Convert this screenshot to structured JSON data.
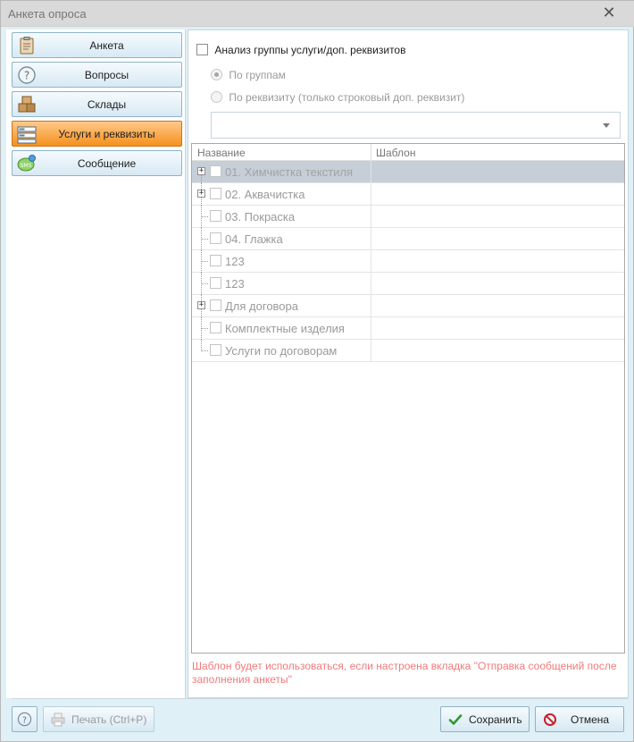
{
  "window": {
    "title": "Анкета опроса",
    "close_glyph": "✕"
  },
  "nav": {
    "items": [
      {
        "label": "Анкета",
        "icon": "clipboard-icon",
        "active": false
      },
      {
        "label": "Вопросы",
        "icon": "question-icon",
        "active": false
      },
      {
        "label": "Склады",
        "icon": "boxes-icon",
        "active": false
      },
      {
        "label": "Услуги и реквизиты",
        "icon": "list-form-icon",
        "active": true
      },
      {
        "label": "Сообщение",
        "icon": "sms-icon",
        "active": false
      }
    ]
  },
  "content": {
    "analysis_checkbox_label": "Анализ группы услуги/доп. реквизитов",
    "radio_by_groups": "По группам",
    "radio_by_attribute": "По реквизиту (только строковый доп. реквизит)",
    "combo_value": "",
    "grid": {
      "columns": [
        "Название",
        "Шаблон"
      ],
      "rows": [
        {
          "name": "01. Химчистка текстиля",
          "template": "",
          "expandable": true,
          "selected": true
        },
        {
          "name": "02. Аквачистка",
          "template": "",
          "expandable": true,
          "selected": false
        },
        {
          "name": "03. Покраска",
          "template": "",
          "expandable": false,
          "selected": false
        },
        {
          "name": "04. Глажка",
          "template": "",
          "expandable": false,
          "selected": false
        },
        {
          "name": "123",
          "template": "",
          "expandable": false,
          "selected": false
        },
        {
          "name": "123",
          "template": "",
          "expandable": false,
          "selected": false
        },
        {
          "name": "Для договора",
          "template": "",
          "expandable": true,
          "selected": false
        },
        {
          "name": "Комплектные изделия",
          "template": "",
          "expandable": false,
          "selected": false
        },
        {
          "name": "Услуги по договорам",
          "template": "",
          "expandable": false,
          "selected": false
        }
      ]
    },
    "note": "Шаблон будет использоваться, если настроена вкладка \"Отправка сообщений после заполнения анкеты\""
  },
  "footer": {
    "help_glyph": "?",
    "print_label": "Печать (Ctrl+P)",
    "save_label": "Сохранить",
    "cancel_label": "Отмена"
  },
  "colors": {
    "accent_active": "#f5901f",
    "note_text": "#f07b7b",
    "selected_row": "#c6ced8"
  }
}
